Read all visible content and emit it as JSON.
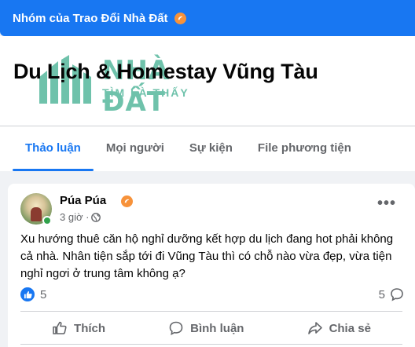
{
  "topbar": {
    "title": "Nhóm của Trao Đổi Nhà Đất"
  },
  "group": {
    "title": "Du Lịch & Homestay Vũng Tàu"
  },
  "watermark": {
    "main": "NHÀ ĐẤT",
    "sub": "TÌM LÀ THẤY"
  },
  "tabs": [
    {
      "label": "Thảo luận",
      "active": true
    },
    {
      "label": "Mọi người",
      "active": false
    },
    {
      "label": "Sự kiện",
      "active": false
    },
    {
      "label": "File phương tiện",
      "active": false
    }
  ],
  "post": {
    "author": "Púa Púa",
    "time": "3 giờ ·",
    "text": "Xu hướng thuê căn hộ nghỉ dưỡng kết hợp du lịch đang hot phải không cả nhà. Nhân tiện sắp tới đi Vũng Tàu thì có chỗ nào vừa đẹp, vừa tiện nghỉ ngơi ở trung tâm không ạ?",
    "reaction_count": "5",
    "comment_count": "5",
    "actions": {
      "like": "Thích",
      "comment": "Bình luận",
      "share": "Chia sẻ"
    }
  },
  "colors": {
    "accent": "#1877f2",
    "badge": "#f7923a",
    "online": "#31a24c"
  }
}
